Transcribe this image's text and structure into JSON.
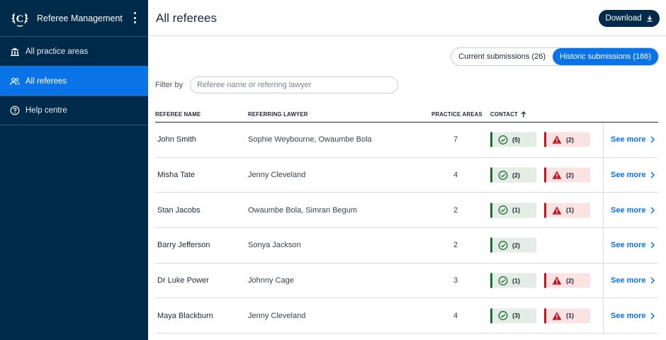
{
  "app": {
    "title": "Referee Management",
    "logo_letter": "C"
  },
  "sidebar": {
    "items": [
      {
        "label": "All practice areas",
        "icon": "bank-icon"
      },
      {
        "label": "All referees",
        "icon": "users-icon"
      },
      {
        "label": "Help centre",
        "icon": "help-icon"
      }
    ]
  },
  "header": {
    "title": "All referees",
    "download_label": "Download"
  },
  "tabs": [
    {
      "label": "Current submissions (26)"
    },
    {
      "label": "Historic submissions (186)"
    }
  ],
  "filter": {
    "label": "Filter by",
    "placeholder": "Referee name or referring lawyer"
  },
  "table": {
    "columns": {
      "name": "REFEREE NAME",
      "lawyer": "REFERRING LAWYER",
      "areas": "PRACTICE AREAS",
      "contact": "CONTACT"
    },
    "see_more_label": "See more",
    "rows": [
      {
        "name": "John Smith",
        "lawyer": "Sophie Weybourne,  Owaumbe Bola",
        "areas": "7",
        "ok": "(5)",
        "warn": "(2)"
      },
      {
        "name": "Misha Tate",
        "lawyer": "Jenny Cleveland",
        "areas": "4",
        "ok": "(2)",
        "warn": "(2)"
      },
      {
        "name": "Stan Jacobs",
        "lawyer": "Owaumbe Bola, Simran Begum",
        "areas": "2",
        "ok": "(1)",
        "warn": "(1)"
      },
      {
        "name": "Barry Jefferson",
        "lawyer": "Sonya Jackson",
        "areas": "2",
        "ok": "(2)",
        "warn": null
      },
      {
        "name": "Dr Luke Power",
        "lawyer": "Johnny Cage",
        "areas": "3",
        "ok": "(1)",
        "warn": "(2)"
      },
      {
        "name": "Maya Blackburn",
        "lawyer": "Jenny Cleveland",
        "areas": "4",
        "ok": "(3)",
        "warn": "(1)"
      }
    ]
  },
  "colors": {
    "sidebar_bg": "#002a4a",
    "accent": "#0a73e8",
    "success": "#1d6b35",
    "danger": "#c4161c"
  }
}
